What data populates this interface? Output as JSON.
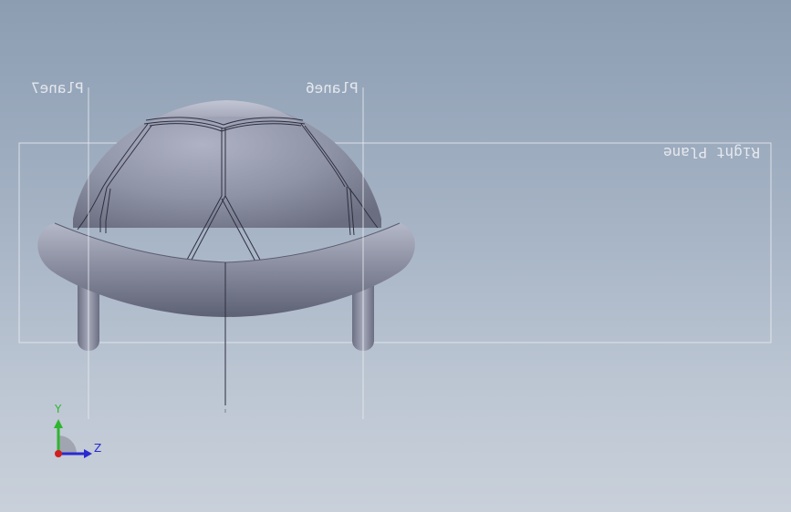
{
  "viewport": {
    "background_top": "#8c9db2",
    "background_bottom": "#c9d0da",
    "model_color": "#8e92a4",
    "plane_color": "#e6eaf0"
  },
  "planes": {
    "plane7": "Plane7",
    "plane6": "Plane6",
    "right_plane": "Right Plane"
  },
  "triad": {
    "y_label": "Y",
    "z_label": "Z",
    "y_color": "#2fb52f",
    "z_color": "#2a2ad0",
    "x_color": "#d02020"
  }
}
